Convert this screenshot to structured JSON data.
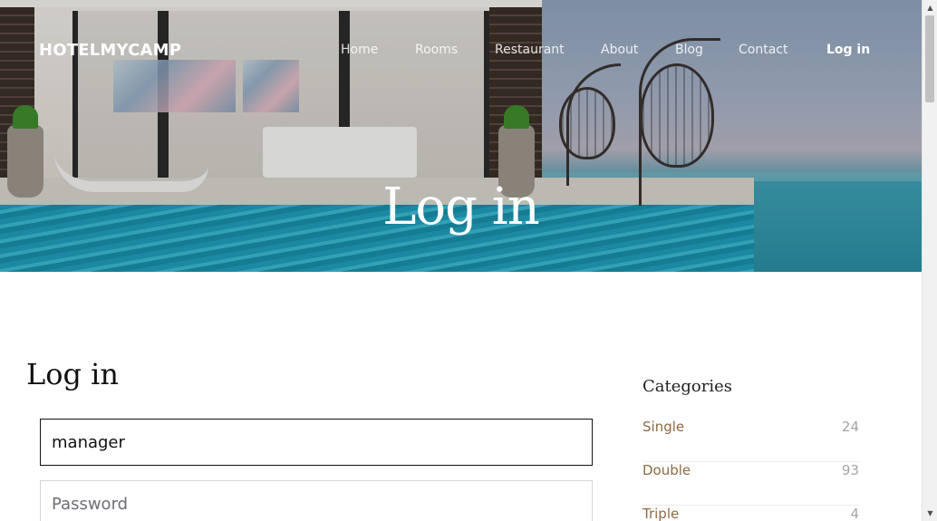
{
  "site": {
    "brand": "HOTELMYCAMP"
  },
  "nav": {
    "items": [
      {
        "label": "Home"
      },
      {
        "label": "Rooms"
      },
      {
        "label": "Restaurant"
      },
      {
        "label": "About"
      },
      {
        "label": "Blog"
      },
      {
        "label": "Contact"
      },
      {
        "label": "Log in",
        "active": true
      }
    ]
  },
  "hero": {
    "title": "Log in"
  },
  "form": {
    "heading": "Log in",
    "username": {
      "value": "manager"
    },
    "password": {
      "value": "",
      "placeholder": "Password"
    }
  },
  "sidebar": {
    "title": "Categories",
    "categories": [
      {
        "name": "Single",
        "count": "24"
      },
      {
        "name": "Double",
        "count": "93"
      },
      {
        "name": "Triple",
        "count": "4"
      }
    ]
  },
  "colors": {
    "accent": "#8c6a44",
    "count": "#a5a5a5",
    "pool": "#1f9db8"
  },
  "icons": {
    "scroll_up": "chevron-up-icon",
    "scroll_down": "chevron-down-icon"
  }
}
